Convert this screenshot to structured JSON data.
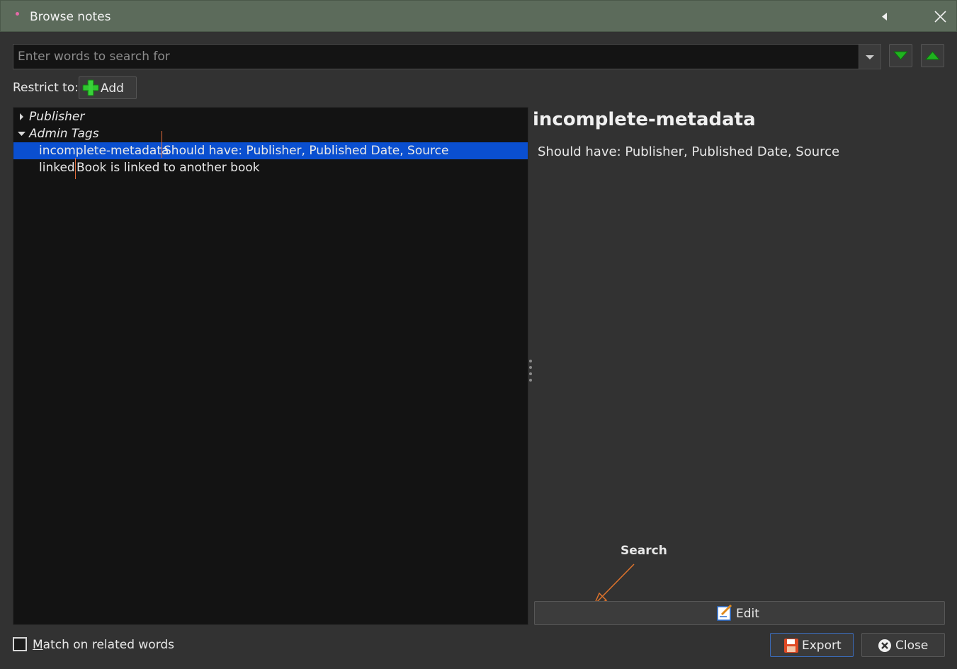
{
  "window": {
    "title": "Browse notes",
    "colors": {
      "titlebar": "#5c6b5b",
      "selection": "#0a4fd0",
      "accent_green": "#1fb31f"
    }
  },
  "search": {
    "placeholder": "Enter words to search for",
    "value": "",
    "icons": {
      "dropdown": "chevron-down-icon",
      "next": "green-arrow-down-icon",
      "previous": "green-arrow-up-icon"
    }
  },
  "restrict": {
    "label": "Restrict to:",
    "add_label": "Add"
  },
  "tree": {
    "categories": [
      {
        "label": "Publisher",
        "expanded": false
      },
      {
        "label": "Admin Tags",
        "expanded": true
      }
    ],
    "notes": [
      {
        "name": "incomplete-metadata",
        "description": "Should have: Publisher, Published Date, Source",
        "selected": true
      },
      {
        "name": "linked",
        "description": "Book is linked to another book",
        "selected": false
      }
    ]
  },
  "detail": {
    "title": "incomplete-metadata",
    "body": "Should have: Publisher, Published Date, Source"
  },
  "annotation": {
    "text": "Search"
  },
  "buttons": {
    "edit": "Edit",
    "export": "Export",
    "close": "Close"
  },
  "match_related": {
    "prefix": "M",
    "rest": "atch on related words",
    "checked": false
  }
}
